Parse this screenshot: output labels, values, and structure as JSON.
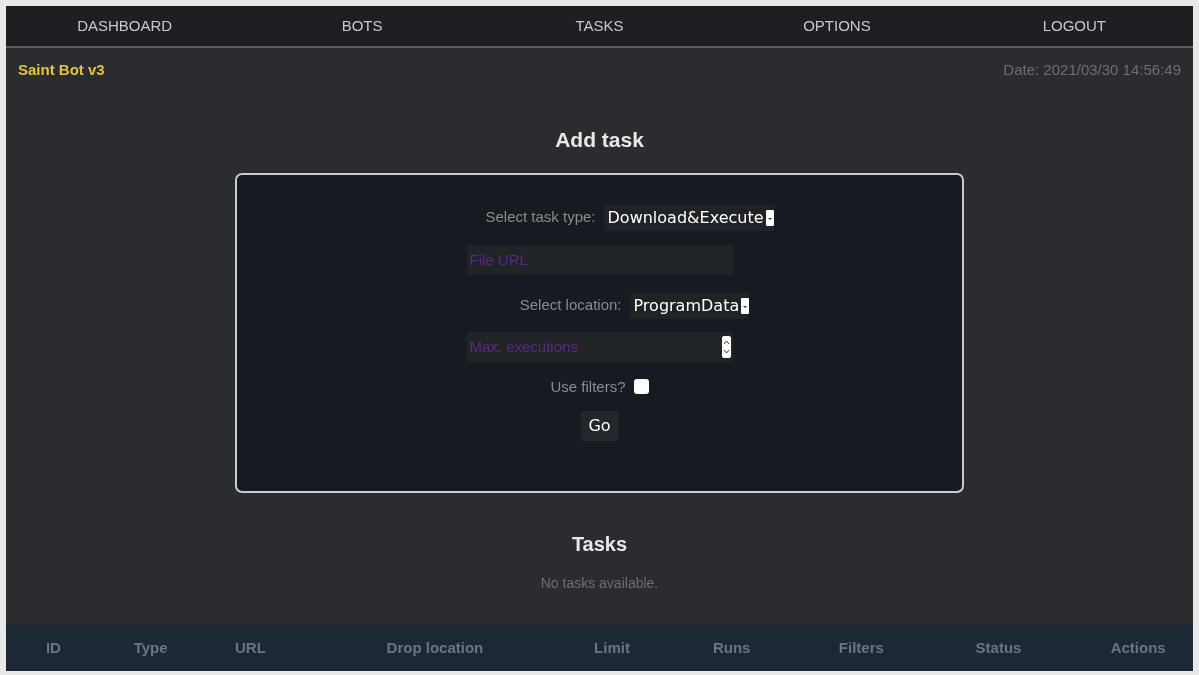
{
  "nav": [
    {
      "label": "DASHBOARD"
    },
    {
      "label": "BOTS"
    },
    {
      "label": "TASKS"
    },
    {
      "label": "OPTIONS"
    },
    {
      "label": "LOGOUT"
    }
  ],
  "brand": "Saint Bot v3",
  "date": "Date: 2021/03/30 14:56:49",
  "add_task": {
    "title": "Add task",
    "task_type": {
      "label": "Select task type:",
      "value": "Download&Execute"
    },
    "file_url": {
      "placeholder": "File URL"
    },
    "location": {
      "label": "Select location:",
      "value": "ProgramData"
    },
    "max_executions": {
      "placeholder": "Max. executions"
    },
    "use_filters": {
      "label": "Use filters?",
      "checked": false
    },
    "button": "Go"
  },
  "tasks": {
    "title": "Tasks",
    "empty": "No tasks available.",
    "columns": [
      "ID",
      "Type",
      "URL",
      "Drop location",
      "Limit",
      "Runs",
      "Filters",
      "Status",
      "Actions"
    ]
  }
}
